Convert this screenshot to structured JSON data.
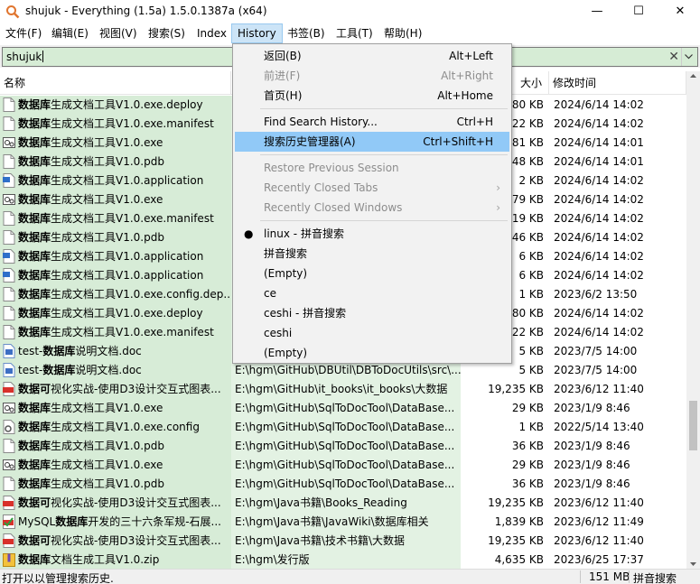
{
  "window": {
    "title": "shujuk - Everything (1.5a) 1.5.0.1387a (x64)",
    "minimize": "—",
    "maximize": "☐",
    "close": "✕"
  },
  "menubar": [
    {
      "label": "文件(F)"
    },
    {
      "label": "编辑(E)"
    },
    {
      "label": "视图(V)"
    },
    {
      "label": "搜索(S)"
    },
    {
      "label": "Index"
    },
    {
      "label": "History"
    },
    {
      "label": "书签(B)"
    },
    {
      "label": "工具(T)"
    },
    {
      "label": "帮助(H)"
    }
  ],
  "search": {
    "value": "shujuk",
    "clear_icon": "✕"
  },
  "columns": {
    "name": "名称",
    "size": "大小",
    "date": "修改时间"
  },
  "rows": [
    {
      "icon": "file",
      "hl": "数据库",
      "rest": "生成文档工具V1.0.exe.deploy",
      "path": "",
      "size": "80 KB",
      "date": "2024/6/14 14:02"
    },
    {
      "icon": "file",
      "hl": "数据库",
      "rest": "生成文档工具V1.0.exe.manifest",
      "path": "",
      "size": "22 KB",
      "date": "2024/6/14 14:02"
    },
    {
      "icon": "exe",
      "hl": "数据库",
      "rest": "生成文档工具V1.0.exe",
      "path": "",
      "size": "81 KB",
      "date": "2024/6/14 14:01"
    },
    {
      "icon": "file",
      "hl": "数据库",
      "rest": "生成文档工具V1.0.pdb",
      "path": "",
      "size": "48 KB",
      "date": "2024/6/14 14:01"
    },
    {
      "icon": "app",
      "hl": "数据库",
      "rest": "生成文档工具V1.0.application",
      "path": "",
      "size": "2 KB",
      "date": "2024/6/14 14:02"
    },
    {
      "icon": "exe",
      "hl": "数据库",
      "rest": "生成文档工具V1.0.exe",
      "path": "",
      "size": "79 KB",
      "date": "2024/6/14 14:02"
    },
    {
      "icon": "file",
      "hl": "数据库",
      "rest": "生成文档工具V1.0.exe.manifest",
      "path": "",
      "size": "19 KB",
      "date": "2024/6/14 14:02"
    },
    {
      "icon": "file",
      "hl": "数据库",
      "rest": "生成文档工具V1.0.pdb",
      "path": "",
      "size": "46 KB",
      "date": "2024/6/14 14:02"
    },
    {
      "icon": "app",
      "hl": "数据库",
      "rest": "生成文档工具V1.0.application",
      "path": "",
      "size": "6 KB",
      "date": "2024/6/14 14:02"
    },
    {
      "icon": "app",
      "hl": "数据库",
      "rest": "生成文档工具V1.0.application",
      "path": "",
      "size": "6 KB",
      "date": "2024/6/14 14:02"
    },
    {
      "icon": "file",
      "hl": "数据库",
      "rest": "生成文档工具V1.0.exe.config.dep...",
      "path": "",
      "size": "1 KB",
      "date": "2023/6/2 13:50"
    },
    {
      "icon": "file",
      "hl": "数据库",
      "rest": "生成文档工具V1.0.exe.deploy",
      "path": "",
      "size": "80 KB",
      "date": "2024/6/14 14:02"
    },
    {
      "icon": "file",
      "hl": "数据库",
      "rest": "生成文档工具V1.0.exe.manifest",
      "path": "",
      "size": "22 KB",
      "date": "2024/6/14 14:02"
    },
    {
      "icon": "doc",
      "pre": "test-",
      "hl": "数据库",
      "rest": "说明文档.doc",
      "path": "",
      "size": "5 KB",
      "date": "2023/7/5 14:00"
    },
    {
      "icon": "doc",
      "pre": "test-",
      "hl": "数据库",
      "rest": "说明文档.doc",
      "path": "E:\\hgm\\GitHub\\DBUtil\\DBToDocUtils\\src\\...",
      "size": "5 KB",
      "date": "2023/7/5 14:00"
    },
    {
      "icon": "pdf",
      "hl": "数据可",
      "rest": "视化实战-使用D3设计交互式图表...",
      "path": "E:\\hgm\\GitHub\\it_books\\it_books\\大数据",
      "size": "19,235 KB",
      "date": "2023/6/12 11:40"
    },
    {
      "icon": "exe",
      "hl": "数据库",
      "rest": "生成文档工具V1.0.exe",
      "path": "E:\\hgm\\GitHub\\SqlToDocTool\\DataBase...",
      "size": "29 KB",
      "date": "2023/1/9 8:46"
    },
    {
      "icon": "cfg",
      "hl": "数据库",
      "rest": "生成文档工具V1.0.exe.config",
      "path": "E:\\hgm\\GitHub\\SqlToDocTool\\DataBase...",
      "size": "1 KB",
      "date": "2022/5/14 13:40"
    },
    {
      "icon": "file",
      "hl": "数据库",
      "rest": "生成文档工具V1.0.pdb",
      "path": "E:\\hgm\\GitHub\\SqlToDocTool\\DataBase...",
      "size": "36 KB",
      "date": "2023/1/9 8:46"
    },
    {
      "icon": "exe",
      "hl": "数据库",
      "rest": "生成文档工具V1.0.exe",
      "path": "E:\\hgm\\GitHub\\SqlToDocTool\\DataBase...",
      "size": "29 KB",
      "date": "2023/1/9 8:46"
    },
    {
      "icon": "file",
      "hl": "数据库",
      "rest": "生成文档工具V1.0.pdb",
      "path": "E:\\hgm\\GitHub\\SqlToDocTool\\DataBase...",
      "size": "36 KB",
      "date": "2023/1/9 8:46"
    },
    {
      "icon": "pdf",
      "hl": "数据可",
      "rest": "视化实战-使用D3设计交互式图表...",
      "path": "E:\\hgm\\Java书籍\\Books_Reading",
      "size": "19,235 KB",
      "date": "2023/6/12 11:40"
    },
    {
      "icon": "pdf2",
      "pre": "MySQL",
      "hl": "数据库",
      "rest": "开发的三十六条军规-石展...",
      "path": "E:\\hgm\\Java书籍\\JavaWiki\\数据库相关",
      "size": "1,839 KB",
      "date": "2023/6/12 11:49"
    },
    {
      "icon": "pdf",
      "hl": "数据可",
      "rest": "视化实战-使用D3设计交互式图表...",
      "path": "E:\\hgm\\Java书籍\\技术书籍\\大数据",
      "size": "19,235 KB",
      "date": "2023/6/12 11:40"
    },
    {
      "icon": "zip",
      "hl": "数据库",
      "rest": "文档生成工具V1.0.zip",
      "path": "E:\\hgm\\发行版",
      "size": "4,635 KB",
      "date": "2023/6/25 17:37"
    }
  ],
  "history_menu": {
    "items": [
      {
        "label": "返回(B)",
        "shortcut": "Alt+Left",
        "disabled": false
      },
      {
        "label": "前进(F)",
        "shortcut": "Alt+Right",
        "disabled": true
      },
      {
        "label": "首页(H)",
        "shortcut": "Alt+Home",
        "disabled": false
      },
      {
        "label": "Find Search History...",
        "shortcut": "Ctrl+H",
        "disabled": false
      },
      {
        "label": "搜索历史管理器(A)",
        "shortcut": "Ctrl+Shift+H",
        "disabled": false
      },
      {
        "label": "Restore Previous Session",
        "shortcut": "",
        "disabled": true
      },
      {
        "label": "Recently Closed Tabs",
        "shortcut": "",
        "disabled": true
      },
      {
        "label": "Recently Closed Windows",
        "shortcut": "",
        "disabled": true
      },
      {
        "label": "linux - 拼音搜索",
        "shortcut": "",
        "disabled": false
      },
      {
        "label": "拼音搜索",
        "shortcut": "",
        "disabled": false
      },
      {
        "label": "(Empty)",
        "shortcut": "",
        "disabled": false
      },
      {
        "label": "ce",
        "shortcut": "",
        "disabled": false
      },
      {
        "label": "ceshi - 拼音搜索",
        "shortcut": "",
        "disabled": false
      },
      {
        "label": "ceshi",
        "shortcut": "",
        "disabled": false
      },
      {
        "label": "(Empty)",
        "shortcut": "",
        "disabled": false
      }
    ],
    "bullet": "●",
    "submenu_arrow": "›"
  },
  "status": {
    "message": "打开以以管理搜索历史.",
    "total_size": "151 MB",
    "filter": "拼音搜索"
  },
  "colors": {
    "row_name_bg": "#d7ecd7",
    "row_path_bg": "#e3f2e3",
    "menu_hover": "#91c9f7",
    "search_bg": "#d6ecd5"
  }
}
